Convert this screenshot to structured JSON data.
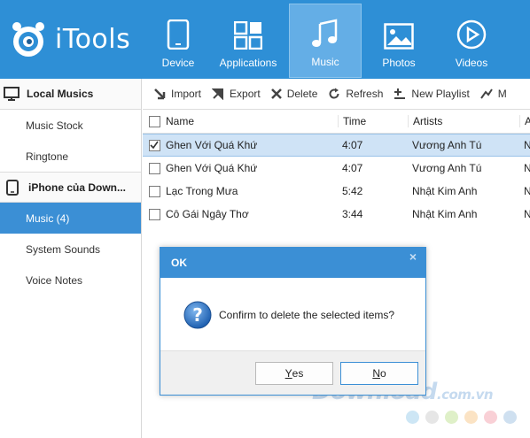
{
  "app": {
    "name": "iTools"
  },
  "nav": [
    {
      "label": "Device",
      "icon": "phone-icon"
    },
    {
      "label": "Applications",
      "icon": "apps-grid-icon"
    },
    {
      "label": "Music",
      "icon": "music-note-icon",
      "active": true
    },
    {
      "label": "Photos",
      "icon": "photo-icon"
    },
    {
      "label": "Videos",
      "icon": "play-icon"
    }
  ],
  "sidebar": {
    "local_section": "Local Musics",
    "local_items": [
      "Music Stock",
      "Ringtone"
    ],
    "device_section": "iPhone của Down...",
    "device_items": [
      "Music (4)",
      "System Sounds",
      "Voice Notes"
    ]
  },
  "toolbar": {
    "import": "Import",
    "export": "Export",
    "delete": "Delete",
    "refresh": "Refresh",
    "new_playlist": "New Playlist",
    "more": "M"
  },
  "table": {
    "columns": [
      "Name",
      "Time",
      "Artists",
      "A"
    ],
    "rows": [
      {
        "name": "Ghen Với Quá Khứ",
        "time": "4:07",
        "artist": "Vương Anh Tú",
        "extra": "N",
        "checked": true
      },
      {
        "name": "Ghen Với Quá Khứ",
        "time": "4:07",
        "artist": "Vương Anh Tú",
        "extra": "N",
        "checked": false
      },
      {
        "name": "Lạc Trong Mưa",
        "time": "5:42",
        "artist": "Nhật Kim Anh",
        "extra": "N",
        "checked": false
      },
      {
        "name": "Cô Gái Ngây Thơ",
        "time": "3:44",
        "artist": "Nhật Kim Anh",
        "extra": "N",
        "checked": false
      }
    ]
  },
  "dialog": {
    "title": "OK",
    "close": "×",
    "message": "Confirm to delete the selected items?",
    "yes_first": "Y",
    "yes_rest": "es",
    "no_first": "N",
    "no_rest": "o"
  },
  "watermark": {
    "main": "Download",
    "suffix": ".com.vn"
  },
  "colors": {
    "header": "#2e8fd6",
    "active_nav": "#64aee6",
    "selection": "#3b8fd5",
    "row_selected": "#cfe3f6"
  }
}
